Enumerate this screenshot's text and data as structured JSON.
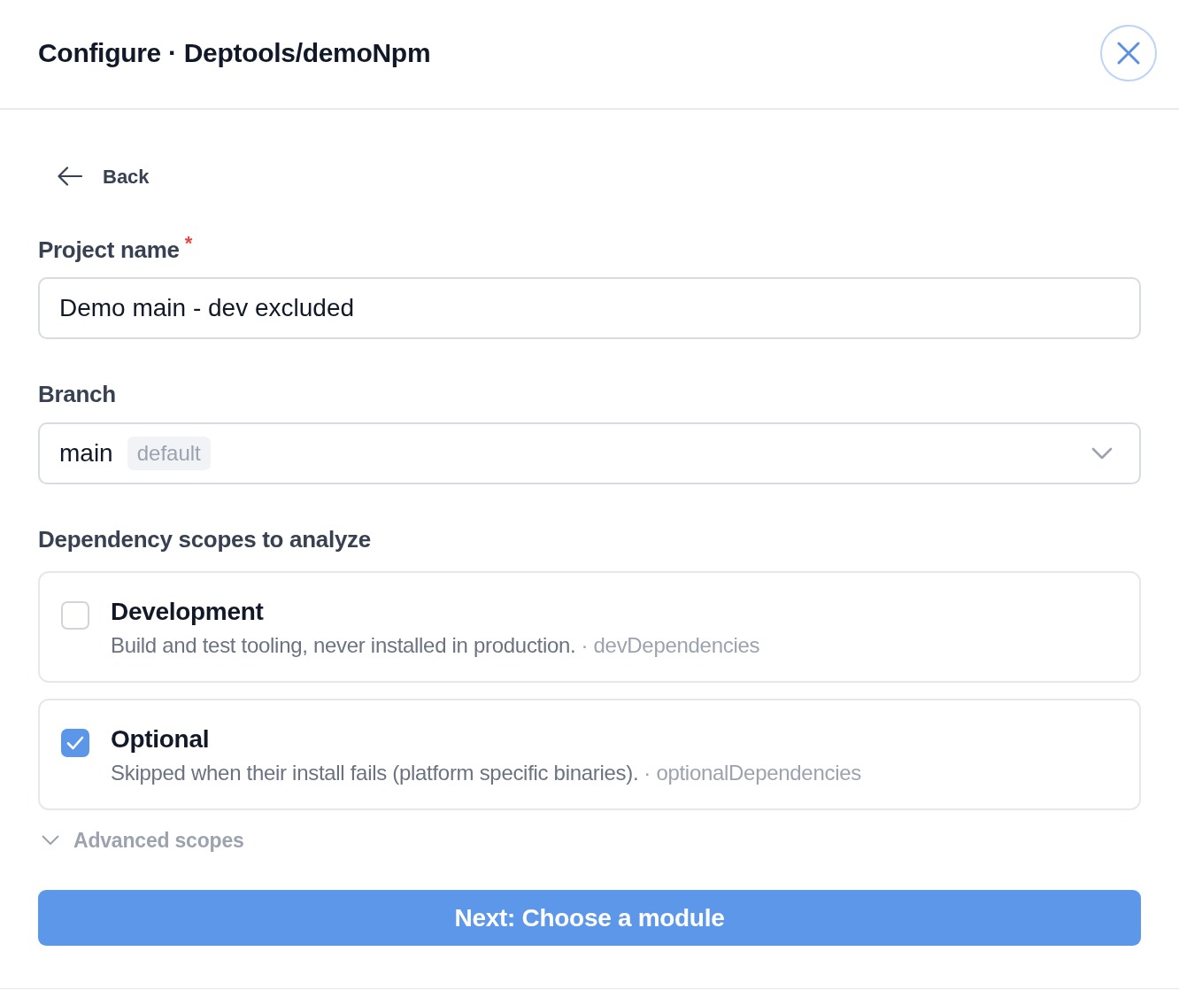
{
  "dialog": {
    "title": "Configure · Deptools/demoNpm"
  },
  "back_link": {
    "label": "Back"
  },
  "fields": [
    {
      "kind": "text",
      "label": "Project name",
      "required_mark": "*",
      "value": "Demo main - dev excluded"
    },
    {
      "kind": "select",
      "label": "Branch",
      "value": "main",
      "badge": "default"
    }
  ],
  "scopes": {
    "heading": "Dependency scopes to analyze",
    "items": [
      {
        "title": "Development",
        "description": "Build and test tooling, never installed in production.",
        "package_key": "· devDependencies",
        "checked": false
      },
      {
        "title": "Optional",
        "description": "Skipped when their install fails (platform specific binaries).",
        "package_key": "· optionalDependencies",
        "checked": true
      }
    ]
  },
  "advanced": {
    "label": "Advanced scopes",
    "expanded": false
  },
  "primary_button": {
    "label": "Next: Choose a module"
  }
}
